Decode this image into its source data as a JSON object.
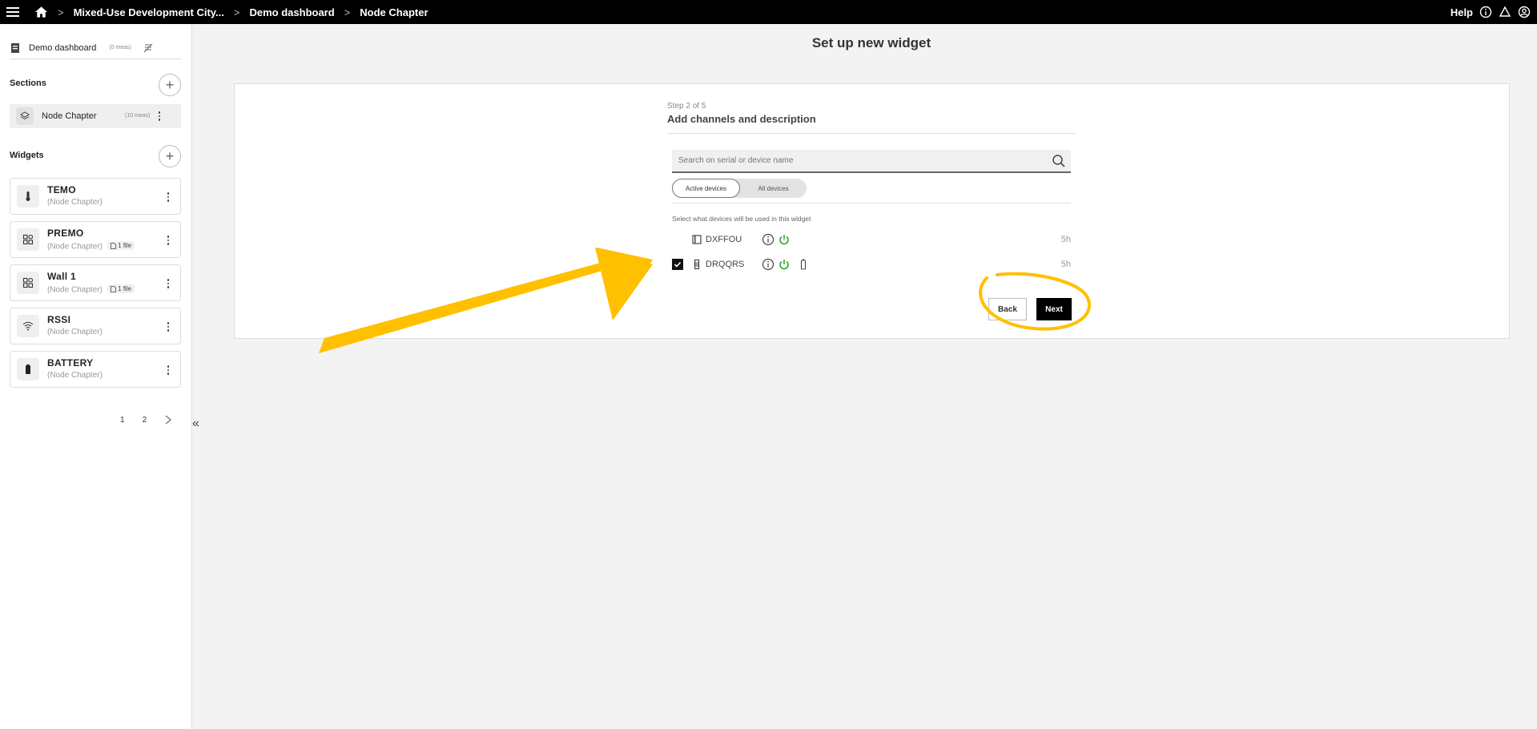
{
  "topbar": {
    "crumbs": [
      "Mixed-Use Development City...",
      "Demo dashboard",
      "Node Chapter"
    ],
    "separator": ">",
    "help": "Help"
  },
  "sidebar": {
    "dashboard": {
      "title": "Demo dashboard",
      "meas": "(0 meas)"
    },
    "sections_heading": "Sections",
    "section": {
      "title": "Node Chapter",
      "meas": "(10 meas)"
    },
    "widgets_heading": "Widgets",
    "widgets": [
      {
        "name": "TEMO",
        "sub": "(Node Chapter)",
        "file": "",
        "icon": "thermometer-icon"
      },
      {
        "name": "PREMO",
        "sub": "(Node Chapter)",
        "file": "1 file",
        "icon": "grid-icon"
      },
      {
        "name": "Wall 1",
        "sub": "(Node Chapter)",
        "file": "1 file",
        "icon": "grid-icon"
      },
      {
        "name": "RSSI",
        "sub": "(Node Chapter)",
        "file": "",
        "icon": "wifi-icon"
      },
      {
        "name": "BATTERY",
        "sub": "(Node Chapter)",
        "file": "",
        "icon": "battery-icon"
      }
    ],
    "pages": [
      "1",
      "2"
    ]
  },
  "main": {
    "title": "Set up new widget",
    "step": "Step 2 of 5",
    "step_title": "Add channels and description",
    "search_placeholder": "Search on serial or device name",
    "toggle": {
      "active": "Active devices",
      "all": "All devices"
    },
    "hint": "Select what devices will be used in this widget",
    "devices": [
      {
        "serial": "DXFFOU",
        "age": "5h",
        "checked": false
      },
      {
        "serial": "DRQQRS",
        "age": "5h",
        "checked": true
      }
    ],
    "back": "Back",
    "next": "Next"
  },
  "colors": {
    "accent_yellow": "#FFC000",
    "power_green": "#2a9d2a"
  }
}
